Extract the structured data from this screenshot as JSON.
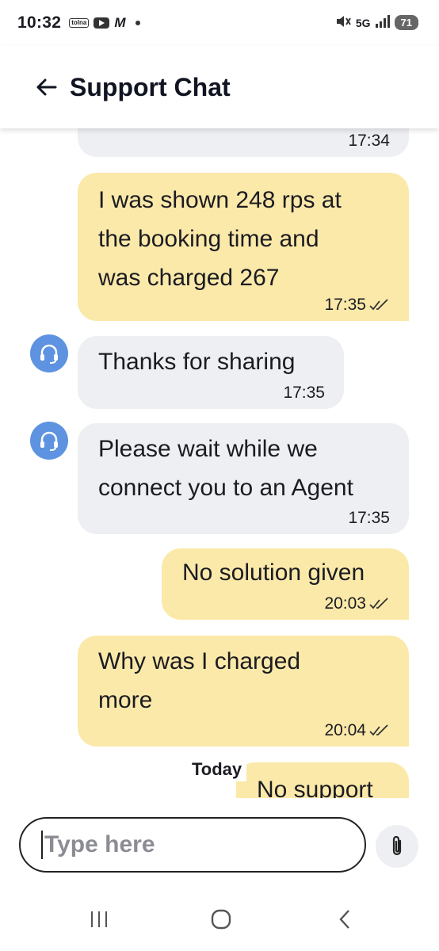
{
  "status_bar": {
    "time": "10:32",
    "left_icons": [
      "daily-icon",
      "youtube-icon",
      "gmail-icon",
      "dot-icon"
    ],
    "mini_badge": "tolna",
    "m_letter": "M",
    "network": "5G",
    "battery": "71",
    "right_icons": [
      "mute-icon",
      "5g-icon",
      "signal-icon",
      "battery-icon"
    ]
  },
  "header": {
    "title": "Support Chat",
    "back_icon": "arrow-left-icon"
  },
  "messages": [
    {
      "id": "m0",
      "side": "in",
      "text": "",
      "time": "17:34",
      "clipped": true
    },
    {
      "id": "m1",
      "side": "out",
      "lines": [
        "I was shown 248 rps at",
        "the booking time and",
        "was charged 267"
      ],
      "time": "17:35",
      "status": "read"
    },
    {
      "id": "m2",
      "side": "in",
      "text": "Thanks for sharing",
      "time": "17:35",
      "avatar": "headset-icon"
    },
    {
      "id": "m3",
      "side": "in",
      "lines": [
        "Please wait while we",
        "connect you to an Agent"
      ],
      "time": "17:35",
      "avatar": "headset-icon"
    },
    {
      "id": "m4",
      "side": "out",
      "text": "No solution given",
      "time": "20:03",
      "status": "read"
    },
    {
      "id": "m5",
      "side": "out",
      "lines": [
        "Why was I charged",
        "more"
      ],
      "time": "20:04",
      "status": "read"
    },
    {
      "id": "m6",
      "side": "out",
      "text": "No support",
      "clipped": true
    }
  ],
  "today_label": "Today",
  "composer": {
    "placeholder": "Type here",
    "attach_icon": "paperclip-icon"
  },
  "nav": {
    "recents_icon": "recents-icon",
    "home_icon": "home-icon",
    "back_icon": "back-chevron-icon"
  },
  "colors": {
    "incoming_bubble": "#eeeff3",
    "outgoing_bubble": "#fbe9a9",
    "avatar": "#5d93e0",
    "text": "#1b1b22"
  }
}
